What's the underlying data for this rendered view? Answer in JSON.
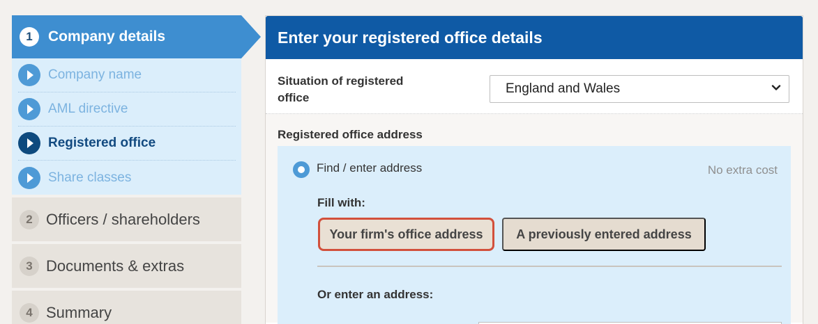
{
  "sidebar": {
    "active_step": {
      "number": "1",
      "label": "Company details"
    },
    "substeps": [
      {
        "label": "Company name",
        "current": false
      },
      {
        "label": "AML directive",
        "current": false
      },
      {
        "label": "Registered office",
        "current": true
      },
      {
        "label": "Share classes",
        "current": false
      }
    ],
    "steps": [
      {
        "number": "2",
        "label": "Officers / shareholders"
      },
      {
        "number": "3",
        "label": "Documents & extras"
      },
      {
        "number": "4",
        "label": "Summary"
      }
    ]
  },
  "panel": {
    "title": "Enter your registered office details",
    "situation": {
      "label": "Situation of registered office",
      "selected": "England and Wales"
    },
    "address": {
      "heading": "Registered office address",
      "option_label": "Find / enter address",
      "cost_note": "No extra cost",
      "fill_with_label": "Fill with:",
      "firm_button": "Your firm's office address",
      "previous_button": "A previously entered address",
      "or_enter_label": "Or enter an address:"
    }
  },
  "colors": {
    "active_blue": "#3e8ed0",
    "header_blue": "#0f5aa5",
    "highlight_red": "#d2503c",
    "substep_bg": "#dbeefb"
  }
}
